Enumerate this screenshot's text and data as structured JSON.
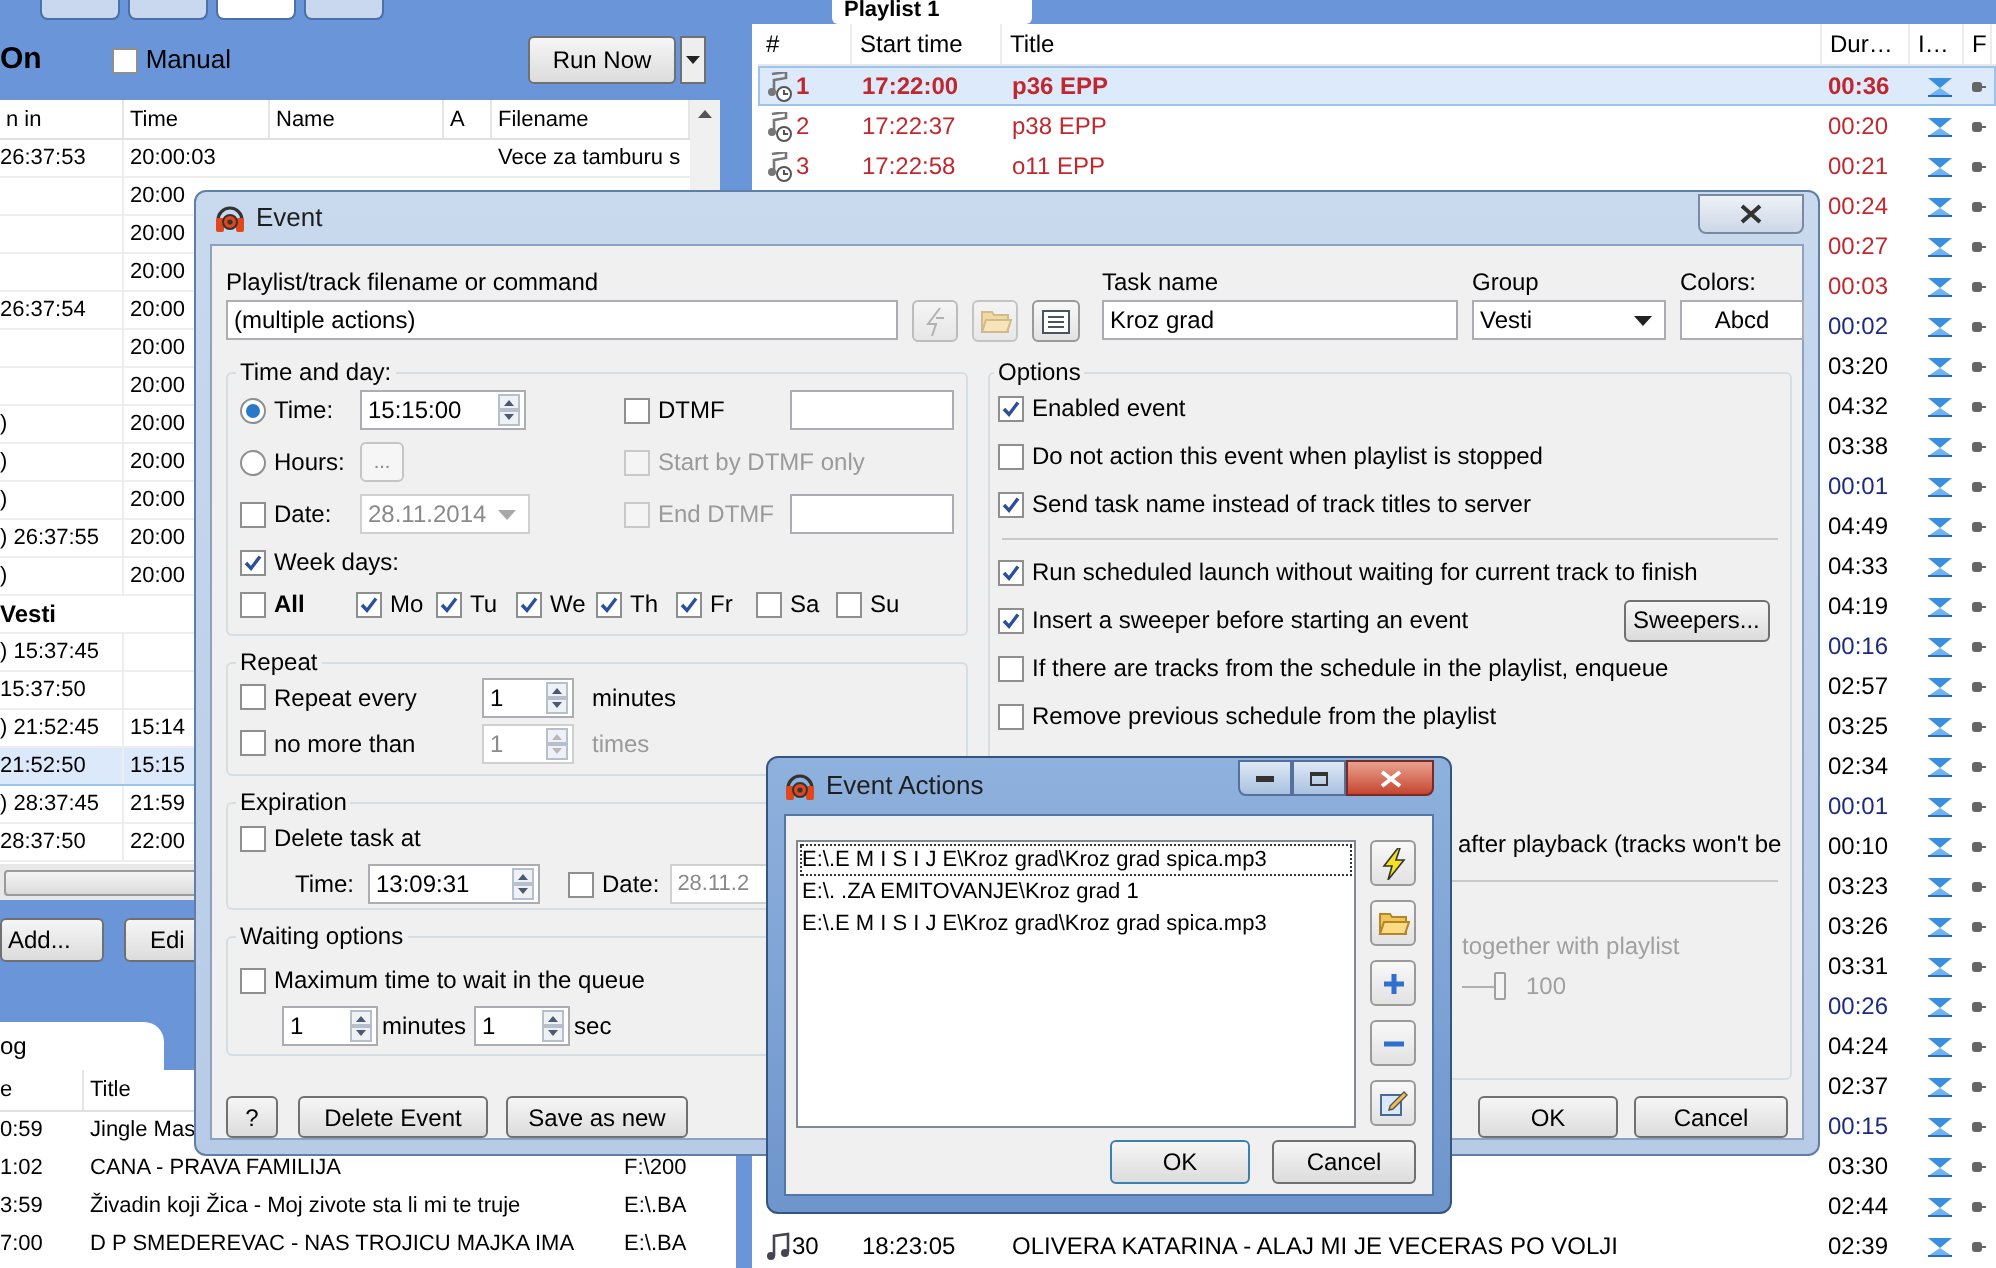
{
  "left_panel": {
    "tabs": [
      {
        "selected": false
      },
      {
        "selected": false
      },
      {
        "selected": true
      },
      {
        "selected": false
      }
    ],
    "toolbar": {
      "status": "On",
      "manual": {
        "label": "Manual",
        "checked": false
      },
      "run_button": "Run Now"
    },
    "schedule": {
      "columns": [
        "n in",
        "Time",
        "Name",
        "A",
        "Filename"
      ],
      "rows": [
        {
          "kind": "row",
          "column_1": "26:37:53",
          "time": "20:00:03",
          "filename": "Vece za tamburu s",
          "selected": false
        },
        {
          "kind": "row",
          "time": "20:00",
          "selected": false
        },
        {
          "kind": "row",
          "time": "20:00",
          "selected": false
        },
        {
          "kind": "row",
          "time": "20:00",
          "selected": false
        },
        {
          "kind": "row",
          "column_1": "26:37:54",
          "time": "20:00",
          "selected": false
        },
        {
          "kind": "row",
          "time": "20:00",
          "selected": false
        },
        {
          "kind": "row",
          "time": "20:00",
          "selected": false
        },
        {
          "kind": "row",
          "column_1": ")",
          "time": "20:00",
          "selected": false
        },
        {
          "kind": "row",
          "column_1": ")",
          "time": "20:00",
          "selected": false
        },
        {
          "kind": "row",
          "column_1": ")",
          "time": "20:00",
          "selected": false
        },
        {
          "kind": "row",
          "column_1": ") 26:37:55",
          "time": "20:00",
          "selected": false
        },
        {
          "kind": "row",
          "column_1": ")",
          "time": "20:00",
          "selected": false
        },
        {
          "kind": "group",
          "label": "Vesti"
        },
        {
          "kind": "row",
          "column_1": ") 15:37:45",
          "selected": false
        },
        {
          "kind": "row",
          "column_1": "15:37:50",
          "selected": false
        },
        {
          "kind": "row",
          "column_1": ") 21:52:45",
          "time": "15:14",
          "selected": false
        },
        {
          "kind": "row",
          "column_1": "21:52:50",
          "time": "15:15",
          "selected": true
        },
        {
          "kind": "row",
          "column_1": ") 28:37:45",
          "time": "21:59",
          "selected": false
        },
        {
          "kind": "row",
          "column_1": "28:37:50",
          "time": "22:00",
          "selected": false
        }
      ]
    },
    "buttons": [
      "Add...",
      "Edi"
    ],
    "log": {
      "tab": {
        "label": "og",
        "selected": true
      },
      "columns": [
        "e",
        "Title"
      ],
      "rows": [
        {
          "time": "0:59",
          "title": "Jingle Mas"
        },
        {
          "time": "1:02",
          "title": "CANA - PRAVA FAMILIJA",
          "file": "F:\\200"
        },
        {
          "time": "3:59",
          "title": "Živadin koji Žica - Moj zivote sta li mi te truje",
          "file": "E:\\.BA"
        },
        {
          "time": "7:00",
          "title": "D P SMEDEREVAC - NAS TROJICU MAJKA IMA",
          "file": "E:\\.BA"
        }
      ]
    }
  },
  "playlist": {
    "tab": "Playlist 1",
    "columns": [
      "#",
      "Start time",
      "Title",
      "Dur…",
      "I…",
      "F"
    ],
    "rows": [
      {
        "kind": "scheduled",
        "number": "1",
        "start": "17:22:00",
        "title": "p36 EPP",
        "duration": "00:36",
        "color": "#c0282d",
        "selected": true
      },
      {
        "kind": "scheduled",
        "number": "2",
        "start": "17:22:37",
        "title": "p38 EPP",
        "duration": "00:20",
        "color": "#c0282d",
        "selected": false
      },
      {
        "kind": "scheduled",
        "number": "3",
        "start": "17:22:58",
        "title": "o11 EPP",
        "duration": "00:21",
        "color": "#c0282d",
        "selected": false
      },
      {
        "duration": "00:24",
        "color": "#c0282d",
        "selected": false
      },
      {
        "duration": "00:27",
        "color": "#c0282d",
        "selected": false
      },
      {
        "duration": "00:03",
        "color": "#c0282d",
        "selected": false
      },
      {
        "duration": "00:02",
        "color": "#1c2a80",
        "selected": false
      },
      {
        "duration": "03:20",
        "color": "#000000",
        "selected": false
      },
      {
        "duration": "04:32",
        "color": "#000000",
        "selected": false
      },
      {
        "duration": "03:38",
        "color": "#000000",
        "selected": false
      },
      {
        "duration": "00:01",
        "color": "#1c2a80",
        "selected": false
      },
      {
        "duration": "04:49",
        "color": "#000000",
        "selected": false
      },
      {
        "duration": "04:33",
        "color": "#000000",
        "selected": false
      },
      {
        "duration": "04:19",
        "color": "#000000",
        "selected": false
      },
      {
        "duration": "00:16",
        "color": "#1c2a80",
        "selected": false
      },
      {
        "duration": "02:57",
        "color": "#000000",
        "selected": false
      },
      {
        "duration": "03:25",
        "color": "#000000",
        "selected": false
      },
      {
        "duration": "02:34",
        "color": "#000000",
        "selected": false
      },
      {
        "duration": "00:01",
        "color": "#1c2a80",
        "selected": false
      },
      {
        "duration": "00:10",
        "color": "#000000",
        "selected": false
      },
      {
        "duration": "03:23",
        "color": "#000000",
        "selected": false
      },
      {
        "duration": "03:26",
        "color": "#000000",
        "selected": false
      },
      {
        "duration": "03:31",
        "color": "#000000",
        "selected": false
      },
      {
        "duration": "00:26",
        "color": "#1c2a80",
        "selected": false
      },
      {
        "duration": "04:24",
        "color": "#000000",
        "selected": false
      },
      {
        "duration": "02:37",
        "color": "#000000",
        "selected": false
      },
      {
        "duration": "00:15",
        "color": "#1c2a80",
        "selected": false
      },
      {
        "duration": "03:30",
        "color": "#000000",
        "selected": false
      },
      {
        "duration": "02:44",
        "color": "#000000",
        "selected": false
      },
      {
        "kind": "track",
        "number": "30",
        "start": "18:23:05",
        "title": "OLIVERA KATARINA - ALAJ MI JE VECERAS PO VOLJI",
        "duration": "02:39",
        "color": "#000000",
        "selected": false
      }
    ]
  },
  "event_dialog": {
    "title": "Event",
    "command": {
      "label": "Playlist/track filename or command",
      "value": "(multiple actions)"
    },
    "task_name": {
      "label": "Task name",
      "value": "Kroz grad"
    },
    "group": {
      "label": "Group",
      "value": "Vesti"
    },
    "colors": {
      "label": "Colors:",
      "sample": "Abcd"
    },
    "time_and_day": {
      "title": "Time and day:",
      "time": {
        "label": "Time:",
        "selected": true,
        "value": "15:15:00"
      },
      "hours": {
        "label": "Hours:",
        "selected": false,
        "button": "..."
      },
      "date": {
        "label": "Date:",
        "checked": false,
        "value": "28.11.2014"
      },
      "dtmf": {
        "label": "DTMF",
        "checked": false,
        "disabled": false
      },
      "start_by_dtmf": {
        "label": "Start by DTMF only",
        "checked": false,
        "disabled": true
      },
      "end_dtmf": {
        "label": "End DTMF",
        "checked": false,
        "disabled": true
      },
      "week_days": {
        "label": "Week days:",
        "checked": true,
        "disabled": false
      },
      "all": {
        "label": "All",
        "checked": false,
        "disabled": false
      },
      "days": [
        {
          "label": "Mo",
          "checked": true
        },
        {
          "label": "Tu",
          "checked": true
        },
        {
          "label": "We",
          "checked": true
        },
        {
          "label": "Th",
          "checked": true
        },
        {
          "label": "Fr",
          "checked": true
        },
        {
          "label": "Sa",
          "checked": false
        },
        {
          "label": "Su",
          "checked": false
        }
      ]
    },
    "repeat": {
      "title": "Repeat",
      "every": {
        "label": "Repeat every",
        "checked": false,
        "disabled": false,
        "value": "1",
        "unit": "minutes"
      },
      "limit": {
        "label": "no more than",
        "checked": false,
        "disabled": true,
        "value": "1",
        "unit": "times"
      }
    },
    "expiration": {
      "title": "Expiration",
      "delete": {
        "label": "Delete task at",
        "checked": false,
        "disabled": false
      },
      "time_label": "Time:",
      "time": "13:09:31",
      "date": {
        "label": "Date:",
        "checked": false,
        "disabled": false,
        "value": "28.11.2"
      }
    },
    "waiting": {
      "title": "Waiting options",
      "max": {
        "label": "Maximum time to wait in the queue",
        "checked": false,
        "disabled": false
      },
      "minutes": "1",
      "minutes_unit": "minutes",
      "seconds": "1",
      "seconds_unit": "sec"
    },
    "options": {
      "title": "Options",
      "items": [
        {
          "kind": "checkbox",
          "label": "Enabled event",
          "checked": true
        },
        {
          "kind": "checkbox",
          "label": "Do not action this event when playlist is stopped",
          "checked": false
        },
        {
          "kind": "checkbox",
          "label": "Send task name instead of track titles to server",
          "checked": true
        },
        {
          "kind": "separator"
        },
        {
          "kind": "checkbox",
          "label": "Run scheduled launch without waiting for current track to finish",
          "checked": true
        },
        {
          "kind": "checkbox",
          "label": "Insert a sweeper before starting an event",
          "checked": true,
          "button": "Sweepers..."
        },
        {
          "kind": "checkbox",
          "label": "If there are tracks from the schedule in the playlist, enqueue",
          "checked": false
        },
        {
          "kind": "checkbox",
          "label": "Remove previous schedule from the playlist",
          "checked": false
        }
      ],
      "partial_text": "after playback (tracks won't be",
      "volume_label": "together with playlist",
      "volume": {
        "level": 1,
        "reading": "100"
      }
    },
    "buttons": {
      "help": "?",
      "delete": "Delete Event",
      "save_new": "Save as new",
      "ok": "OK",
      "cancel": "Cancel"
    }
  },
  "actions_dialog": {
    "title": "Event Actions",
    "items": [
      {
        "text": "E:\\.E M I S I J E\\Kroz grad\\Kroz grad spica.mp3",
        "selected": true
      },
      {
        "text": "E:\\. .ZA EMITOVANJE\\Kroz grad 1",
        "selected": false
      },
      {
        "text": "E:\\.E M I S I J E\\Kroz grad\\Kroz grad spica.mp3",
        "selected": false
      }
    ],
    "ok": "OK",
    "cancel": "Cancel"
  }
}
